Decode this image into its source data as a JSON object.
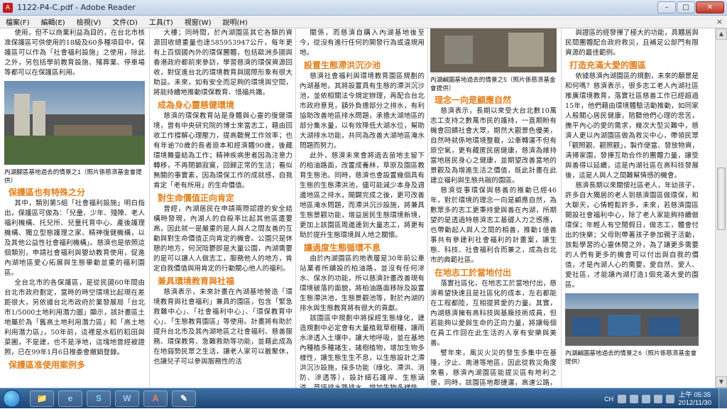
{
  "window": {
    "title": "1122-P4-C.pdf - Adobe Reader",
    "app_icon": "A"
  },
  "window_buttons": {
    "minimize": "–",
    "maximize": "□",
    "close": "✕"
  },
  "menu": [
    {
      "label": "檔案(F)"
    },
    {
      "label": "編輯(E)"
    },
    {
      "label": "檢視(V)"
    },
    {
      "label": "文件(D)"
    },
    {
      "label": "工具(T)"
    },
    {
      "label": "視窗(W)"
    },
    {
      "label": "說明(H)"
    }
  ],
  "menu_close": "×",
  "doc": {
    "col1": {
      "p1": "使用，但不以商業利益為目的，在台北市核准保護區可供使用的18級及60多種項目中，保護區可以作為「社會福利設施」之使用，除此之外，另包括學前教育設施、殯葬業、停車場等都可以在保護區利用。",
      "caption1": "內湖腳區基地過去的情景之1（照片係慈濟基金會提供）",
      "h1": "保護區也有特殊之分",
      "p2": "其中，類別第5組「社會福利設施」明白指出，保護區可做為：「兒童、少年、殘障、老人福利機構、托兒所、兒童托育中心、產後護理機構、獨立型態護理之家、精神復健機構，以及其他公益性社會福利機構」。慈濟也是依照這個類別，申請社會福利與嬰幼教育使用，促進內湖地區愛心拓展與生態舉動並重的福利園區。",
      "p3": "全台北市的各保護區，是從民國60年間由台北市政府劃定，當時的時空環境比起現在差距很大，另依據台北市政府於業發展局「台北市1/5000土地利用潛力圖」顯示，該計畫區土地屬於為「舊高土地利用潛力區」和「高土地利用潛力區」，50年前，這裡是水稻的稻田與菜圃，不是建，也不是淨地，這塊地曾經被證照，已在99年1月6日推委會撤銷登錄。",
      "h2": "保護區准使用案例多"
    },
    "col2": {
      "p1": "大樓；同時間，於內湖園區其它各類的資源回收總重量也達585953947公斤，每年更有上百個國內外的環保團體，包括歐洲多國與香港政府都前來參訪，學習慈濟的環保資源回收，對促進台北的環境教育與國際形象有很大助益。未來，如有安全而足夠的環境與空間，將能持續地推動環保教育、惜福共識。",
      "h1": "成為身心靈慈健環境",
      "p2": "慈濟的環保教育站是身體與心靈的復健環境，曾有中央研究院的博士來當志工，藉由回收工作撐解心理壓力，提高聽覺工作效率；也有年逾70歲的長者原本和經濟體90歲，後藏環境舞臺結為工作；精神疾病患者因為注意力轉移，不再閉鎖寂寞，回歸正常的生活；看似無關的事實素，因為環保工作的成就感，自我肯定「老有所用」的生命價值。",
      "h2": "對生命價值正向肯定",
      "p3": "曾經，內湖居民在申請兩際認證的安全結構時發現，內湖人的自殺率比起其他區還要高，因此就一是嚴重的是人與人之間友善的互動與對生命價值正向肯定的機會。公園只是休憩的地方，何況陰鬱即是大量公園，內湖需要的是可以讓人人做志工，服務他人的地方，肯定自我價值與用肯定的行動關心他人的福利。",
      "h3": "兼具環境教育與社福",
      "p4": "慈濟表示，未來計畫在內湖基地營造「環境教育與社會福利」兼具的園區，包含「緊急救難中心」、「社會福利中心」、「環保教育中心」、「生態教育園區」等使用。計畫將有助於提升台北市及其內湖地區之社會福利、慈善服務、環保教育、急難救助等功能，並藉此成為在地弱勢民眾之生活，讓老人家可以散聚休，也讓兒子可以參與服務性的活"
    },
    "col3": {
      "p1": "關係，而慈濟自購入內湖基地後至今，從沒有進行任何的開發行為或違規用地。",
      "h1": "設置生態滯洪沉沙池",
      "p2": "慈濟社會福利與環境教育園區規劃的內湖基地，其將設置具有生態的滯洪沉沙池，並依相關法令規定辦理，再配合台北市政府意見，額外負擔部分之排水，有利協助改善地區排水問題，承擔大湖地區的部分集水量，以有效降低大湖水位，幫助大湖排水功能，共同為改善大湖地區淹水問題而努力。",
      "p3": "此外，慈濟未來會將過去苗地主留下的柏油路面，改置成養林，草原及園區教育生態池。同時，慈濟也會設置幾個具有生態的生態滯洪池，儘可能減少本身及週邊地區之排水，開闢完成之後，更可改善地區淹水問題，而滯洪沉沙設施，將兼具生態景觀功能，增益居民生態環境新境，更加上該園區周邊連到大量志工，將更有助於提升生態環境與人地之關懷。",
      "h2": "讓過度生態循環不息",
      "p4": "由於內湖園區的地表層是30年前公車站業者所鋪設的柏油路，並沒有任何滲水、保水的功能，所以慈濟計畫改善現有環境破落的面貌，將柏油路面移除及設置生態滯洪池，生態景觀池等，對於內湖的排水與生態教育將有很大的貢獻。",
      "p5": "該園區中規劃中將採經生態綠化，建造規劃中必定會有大量植栽草樹種，讓雨水滲透入土壤中，讓大地呼吸，並在基地內種植多種諸生，諸樹植物，增加生物多樣性，讓生態生生不息，以生態設計之滯洪沉沙設施，採多功能（綠化、滯洪、消防、滲透等），設計細石護岸、生態涵道、草坪排水路排水、增加生物多樣性，讓潛滲生態循環不息。"
    },
    "col4": {
      "caption1": "內湖鹹園基地過去的情景之5（照片係慈濟基金會提供）",
      "h1": "理念一向是顧應自然",
      "p1": "慈濟表示，長期以來受大台北數10萬志工支持之數萬市民的護持，一直期盼有機會回饋社會大眾，期然大觀景色優美，自然時就係地環境整載，公車轉運不但有原空氣，更有藏匿民居健康，慈濟為維持當地居民身心之健康，並期望改善當地的景觀及為增進生活之價值，既此計畫在此建立福利與生態共融的園區。",
      "p2": "慈濟從事環保與慈善的推動已經46年，對於環境的理念一向是顧應自然，為數眾多的志工更秉持愛與善在內湖，所期望的是透過特慈濟志工基礎人力之感應，也帶動起人與人之間的相善，推動1億善事共有參建利社會福利的計畫案，讓生態、科技、社會福利合而兼之，成為台北市的典範社區。",
      "h2": "在地志工於當地付出",
      "p3": "落實社區化，在地志工於當地付出，慈濟希望快速且是社區化的成本，左右都能在工程都陸，互相提昇愛的力量。其實，內湖慈濟擁有高科技與基廠技術成員，但若能夠以愛與生命的正向力量，將讓每個在員工作回在此生活的人享有安樂與美善。",
      "p4": "譬年來，風災火災的發生多集中在基隆，汐止、南港等地區，因此從救災角度來看，慈濟內湖園區能提災區有地利之便，同時，該園區地鄰捷運，高速公路，及快速道路系統，更方便大台北各地志工"
    },
    "col5": {
      "p1": "與證區的經發揮了極大的功能，具體居與民間團體配合政府救災，且補足公部門有限資源的最佳範例。",
      "h1": "打造充滿大愛的園區",
      "p2": "依據慈濟內湖園區的規劃，未來的願景是和何嗎？慈濟表示，很多志工老人內湖社區推廣環境教育，落實社區慈善工作已經超過15年，他們藉由環境體驗活動推動，如同家人般關心居民健康，陪聽他們心理的悲苦，撫平內心的愛的需求，幾次大型災難中，慈濟人更以內湖園區做為救災中心，帶領民眾「觀照觀、觀照觀」，製作便當、發放物資，清掃家園，發揮互助合作的團體力量，讓受與善得以延續，這是內湖社區在高科技發展後，這是人與人之間難幫情感的機會。",
      "p3": "慈濟長期以來關懷社區老人，年幼孩子，許多自大獨居的老人到慈濟園區做環保，和大聊天，心情輕鬆許多，未來，若慈濟園區開設社會福利中心，除了老人家能夠持續做環保；年輕人有空閒假日，做志工，體會付出的快樂；父母則帶著孩子參加親子活動，放鬆學習的心靈休閒之外，為了讓更多需要的人們有更多的機會可以付出與自我的價值，才是內湖人心的需要，愛自然、愛人、愛社區，才能讓內湖打造1個充滿大愛的園區。",
      "caption1": "內湖鹹園基地過去的情景之6（照片係慈濟基金會提供）"
    }
  },
  "taskbar": {
    "apps": [
      {
        "icon": "folder-icon",
        "glyph": "📁"
      },
      {
        "icon": "ie-icon",
        "glyph": "e"
      },
      {
        "icon": "skype-icon",
        "glyph": "S"
      },
      {
        "icon": "word-icon",
        "glyph": "W"
      },
      {
        "icon": "acrobat-icon",
        "glyph": "A"
      },
      {
        "icon": "paint-icon",
        "glyph": "✎"
      }
    ],
    "ime": "CH",
    "time": "上午 05:35",
    "date": "2012/11/30"
  }
}
